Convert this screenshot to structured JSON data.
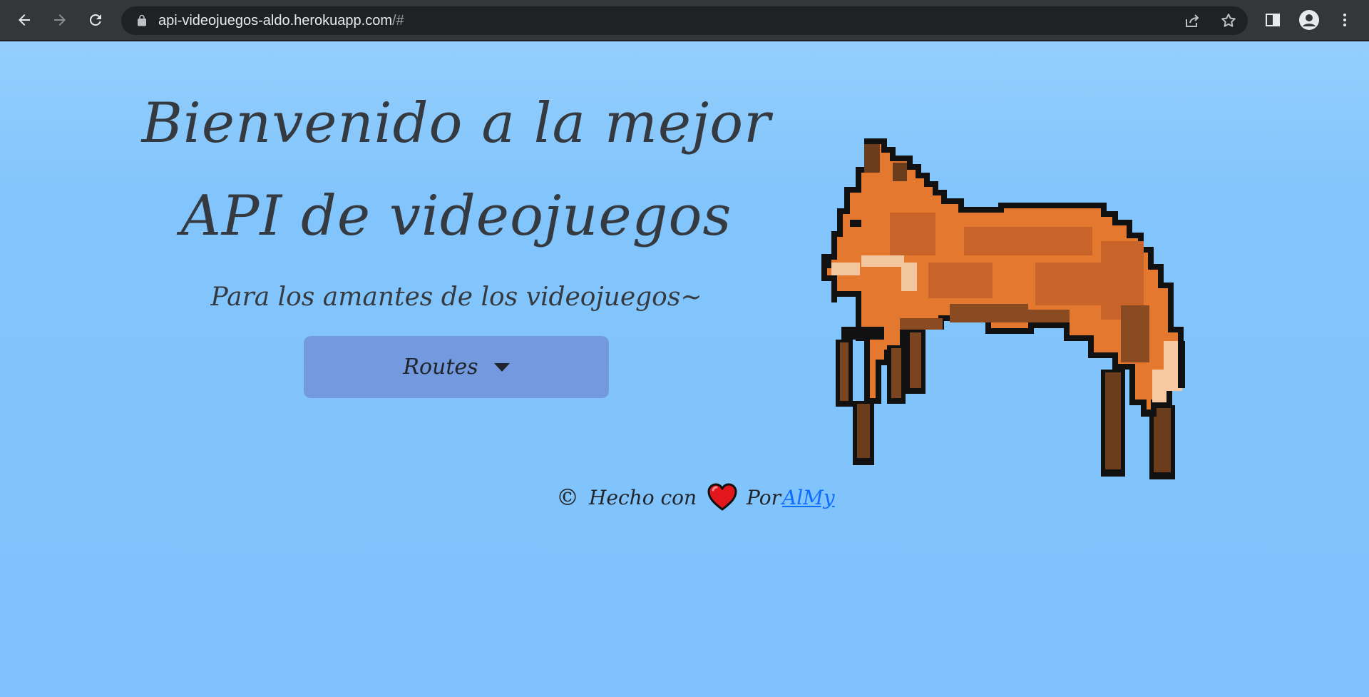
{
  "browser": {
    "url_host": "api-videojuegos-aldo.herokuapp.com",
    "url_path": "/#"
  },
  "hero": {
    "title_line1": "Bienvenido a la mejor",
    "title_line2": "API de videojuegos",
    "subtitle": "Para los amantes de los videojuegos~",
    "routes_button": "Routes"
  },
  "footer": {
    "copyright_symbol": "©",
    "made_with": "Hecho con",
    "by": "Por",
    "author_link": "AlMy"
  },
  "colors": {
    "page_background": "#80c3fc",
    "button_background": "#7399de",
    "text_dark": "#343a40",
    "link": "#0d6efd",
    "chrome_bar": "#35363a"
  },
  "icons": {
    "back": "arrow-left-icon",
    "forward": "arrow-right-icon",
    "reload": "reload-icon",
    "lock": "lock-icon",
    "share": "share-icon",
    "bookmark": "star-icon",
    "side_panel": "side-panel-icon",
    "profile": "profile-icon",
    "menu": "kebab-menu-icon",
    "heart": "heart-icon",
    "mascot": "pixel-fox-image"
  }
}
